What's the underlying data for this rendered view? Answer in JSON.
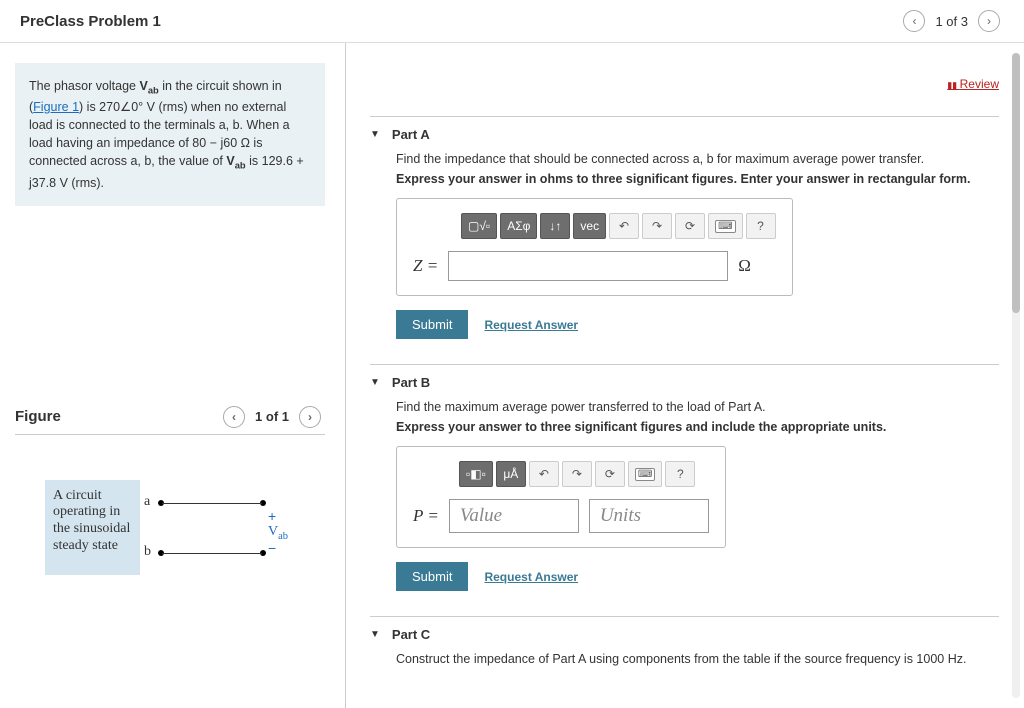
{
  "header": {
    "title": "PreClass Problem 1",
    "counter": "1 of 3"
  },
  "review_label": "Review",
  "problem": {
    "pre": "The phasor voltage ",
    "vab": "V",
    "vabsub": "ab",
    "p1": " in the circuit shown in (",
    "figlink": "Figure 1",
    "p2": ") is 270∠0° V (rms) when no external load is connected to the terminals a, b. When a load having an impedance of 80 − j60 Ω is connected across a, b, the value of ",
    "vab2": "V",
    "vab2sub": "ab",
    "p3": " is 129.6 + j37.8 V (rms)."
  },
  "figure": {
    "label": "Figure",
    "counter": "1 of 1",
    "box_text": "A circuit operating in the sinusoidal steady state",
    "a": "a",
    "b": "b",
    "plus": "+",
    "minus": "−",
    "vab": "V",
    "vabsub": "ab"
  },
  "partA": {
    "title": "Part A",
    "instr": "Find the impedance that should be connected across a, b for maximum average power transfer.",
    "bold": "Express your answer in ohms to three significant figures. Enter your answer in rectangular form.",
    "var": "Z =",
    "unit": "Ω",
    "submit": "Submit",
    "req": "Request Answer",
    "tb": {
      "t1": "▢√▫",
      "t2": "ΑΣφ",
      "t3": "↓↑",
      "t4": "vec",
      "undo": "↶",
      "redo": "↷",
      "reset": "⟳",
      "kbd": "⌨",
      "help": "?"
    }
  },
  "partB": {
    "title": "Part B",
    "instr": "Find the maximum average power transferred to the load of Part A.",
    "bold": "Express your answer to three significant figures and include the appropriate units.",
    "var": "P =",
    "value_ph": "Value",
    "units_ph": "Units",
    "submit": "Submit",
    "req": "Request Answer",
    "tb": {
      "t1": "▫◧▫",
      "t2": "μÅ",
      "undo": "↶",
      "redo": "↷",
      "reset": "⟳",
      "kbd": "⌨",
      "help": "?"
    }
  },
  "partC": {
    "title": "Part C",
    "instr": "Construct the impedance of Part A using components from the table if the source frequency is 1000 Hz."
  }
}
